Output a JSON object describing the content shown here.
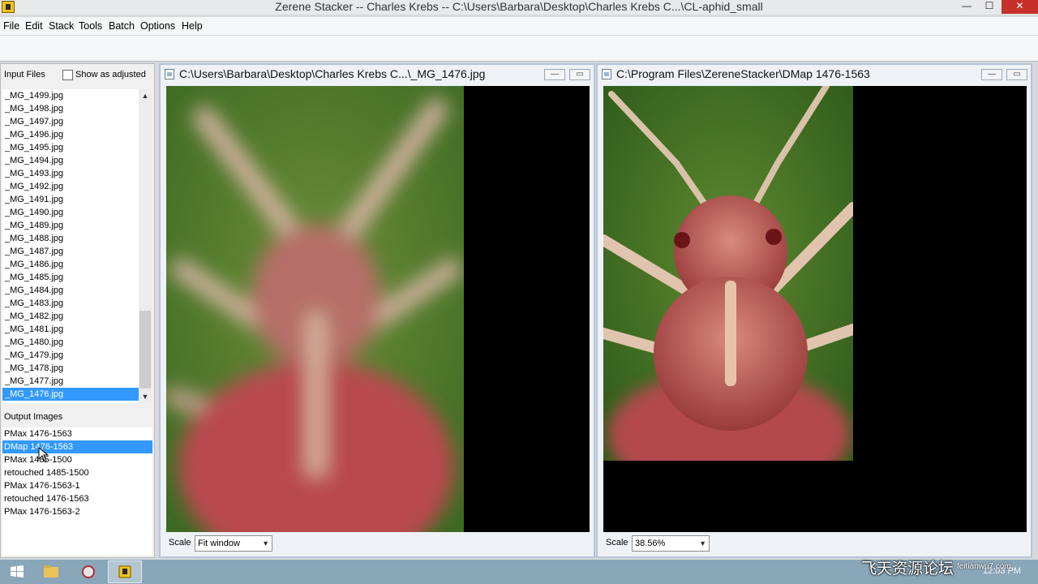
{
  "window": {
    "title": "Zerene Stacker -- Charles Krebs -- C:\\Users\\Barbara\\Desktop\\Charles Krebs C...\\CL-aphid_small"
  },
  "menu": [
    "File",
    "Edit",
    "Stack",
    "Tools",
    "Batch",
    "Options",
    "Help"
  ],
  "input_panel": {
    "label": "Input Files",
    "show_adjusted_label": "Show as adjusted",
    "files": [
      "_MG_1499.jpg",
      "_MG_1498.jpg",
      "_MG_1497.jpg",
      "_MG_1496.jpg",
      "_MG_1495.jpg",
      "_MG_1494.jpg",
      "_MG_1493.jpg",
      "_MG_1492.jpg",
      "_MG_1491.jpg",
      "_MG_1490.jpg",
      "_MG_1489.jpg",
      "_MG_1488.jpg",
      "_MG_1487.jpg",
      "_MG_1486.jpg",
      "_MG_1485.jpg",
      "_MG_1484.jpg",
      "_MG_1483.jpg",
      "_MG_1482.jpg",
      "_MG_1481.jpg",
      "_MG_1480.jpg",
      "_MG_1479.jpg",
      "_MG_1478.jpg",
      "_MG_1477.jpg",
      "_MG_1476.jpg"
    ],
    "selected_file": "_MG_1476.jpg"
  },
  "output_panel": {
    "label": "Output Images",
    "items": [
      "PMax 1476-1563",
      "DMap 1476-1563",
      "PMax 1485-1500",
      "retouched 1485-1500",
      "PMax 1476-1563-1",
      "retouched 1476-1563",
      "PMax 1476-1563-2"
    ],
    "selected_item": "DMap 1476-1563"
  },
  "left_view": {
    "title": "C:\\Users\\Barbara\\Desktop\\Charles Krebs C...\\_MG_1476.jpg",
    "scale_label": "Scale",
    "scale_value": "Fit window"
  },
  "right_view": {
    "title": "C:\\Program Files\\ZereneStacker\\DMap 1476-1563",
    "scale_label": "Scale",
    "scale_value": "38.56%"
  },
  "taskbar": {
    "clock": "12:03 PM"
  },
  "watermark": {
    "text": "飞天资源论坛",
    "url": "feitianwu7.com"
  },
  "colors": {
    "selection": "#3399ff",
    "taskbar": "#8aa6b9",
    "close_button": "#c7302a"
  }
}
